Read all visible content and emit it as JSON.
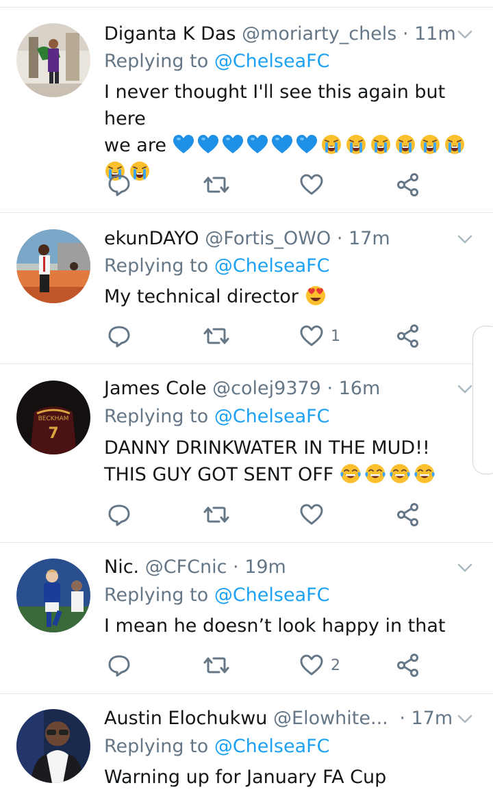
{
  "reply_prefix": "Replying to",
  "tweets": [
    {
      "name": "Diganta K Das",
      "handle": "@moriarty_chels",
      "time": "· 11m",
      "reply_to": "@ChelseaFC",
      "line1": "I never thought I'll see this again but here",
      "line2": "we are",
      "like_count": ""
    },
    {
      "name": "ekunDAYO",
      "handle": "@Fortis_OWO",
      "time": "· 17m",
      "reply_to": "@ChelseaFC",
      "line1": "My technical director",
      "like_count": "1"
    },
    {
      "name": "James Cole",
      "handle": "@colej9379",
      "time": "· 16m",
      "reply_to": "@ChelseaFC",
      "line1": "DANNY DRINKWATER IN THE MUD!!",
      "line2": "THIS GUY GOT SENT OFF",
      "like_count": ""
    },
    {
      "name": "Nic.",
      "handle": "@CFCnic",
      "time": "· 19m",
      "reply_to": "@ChelseaFC",
      "line1": "I mean he doesn’t look happy in that",
      "like_count": "2"
    },
    {
      "name": "Austin Elochukwu",
      "handle": "@Elowhite...",
      "time": "· 17m",
      "reply_to": "@ChelseaFC",
      "line1": "Warning up for January FA Cup"
    }
  ],
  "colors": {
    "link": "#1da1f2",
    "muted": "#657786",
    "divider": "#e1e8ed",
    "heart_blue": "#1e90e6",
    "emoji_yellow": "#fbc02d"
  },
  "icons": [
    "reply-icon",
    "retweet-icon",
    "like-icon",
    "share-icon",
    "chevron-down-icon",
    "blue-heart-emoji",
    "crying-face-emoji",
    "heart-eyes-emoji",
    "tears-of-joy-emoji"
  ]
}
